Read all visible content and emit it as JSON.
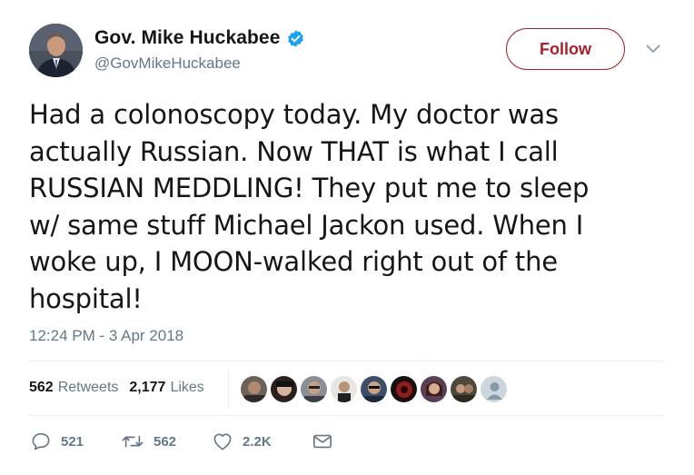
{
  "author": {
    "display_name": "Gov. Mike Huckabee",
    "handle": "@GovMikeHuckabee",
    "verified": true
  },
  "follow_label": "Follow",
  "tweet": {
    "lines": [
      "Had a colonoscopy today.  My doctor was",
      "actually Russian.  Now THAT is what I call",
      "RUSSIAN MEDDLING!  They put me to sleep",
      "w/ same stuff Michael Jackon used.  When I",
      "woke up, I MOON-walked right out of the",
      "hospital!"
    ],
    "timestamp": "12:24 PM - 3 Apr 2018"
  },
  "stats": {
    "retweets_count": "562",
    "retweets_label": "Retweets",
    "likes_count": "2,177",
    "likes_label": "Likes"
  },
  "actions": {
    "reply_count": "521",
    "retweet_count": "562",
    "like_count": "2.2K"
  },
  "colors": {
    "follow_accent": "#a6202d",
    "verified_blue": "#1da1f2",
    "secondary_text": "#657786"
  },
  "icons": [
    "verified-badge-icon",
    "chevron-down-icon",
    "reply-icon",
    "retweet-icon",
    "heart-icon",
    "direct-message-icon"
  ]
}
